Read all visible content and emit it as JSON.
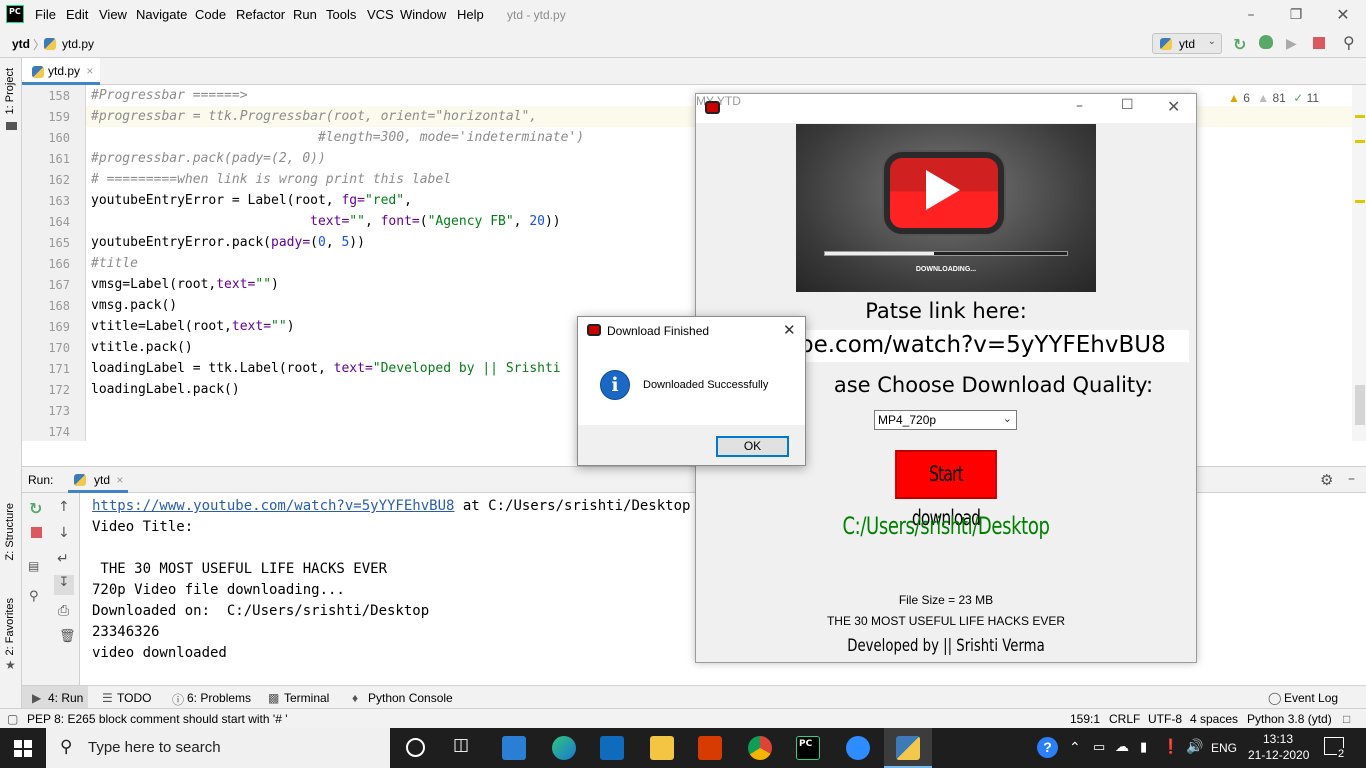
{
  "window": {
    "title": "ytd - ytd.py",
    "menu": [
      "File",
      "Edit",
      "View",
      "Navigate",
      "Code",
      "Refactor",
      "Run",
      "Tools",
      "VCS",
      "Window",
      "Help"
    ]
  },
  "navbar": {
    "project": "ytd",
    "file": "ytd.py",
    "run_config": "ytd"
  },
  "left_stripe": {
    "project": "1: Project",
    "structure": "Z: Structure",
    "favorites": "2: Favorites"
  },
  "editor": {
    "tab": "ytd.py",
    "line_numbers": [
      "158",
      "159",
      "160",
      "161",
      "162",
      "163",
      "164",
      "165",
      "166",
      "167",
      "168",
      "169",
      "170",
      "171",
      "172",
      "173",
      "174"
    ],
    "analysis": {
      "warnings": "6",
      "weak_warnings": "81",
      "typos": "11"
    },
    "code": {
      "l158": "#Progressbar ======>",
      "l159": "#progressbar = ttk.Progressbar(root, orient=\"horizontal\",",
      "l160": "                             #length=300, mode='indeterminate')",
      "l161": "#progressbar.pack(pady=(2, 0))",
      "l162": "# =========when link is wrong print this label",
      "l163a": "youtubeEntryError = Label(root, ",
      "l163b": "fg=",
      "l163c": "\"red\"",
      "l163d": ",",
      "l164a": "                            ",
      "l164b": "text=",
      "l164c": "\"\"",
      "l164d": ", ",
      "l164e": "font=",
      "l164f": "(",
      "l164g": "\"Agency FB\"",
      "l164h": ", ",
      "l164i": "20",
      "l164j": "))",
      "l165a": "youtubeEntryError.pack(",
      "l165b": "pady=",
      "l165c": "(",
      "l165d": "0",
      "l165e": ", ",
      "l165f": "5",
      "l165g": "))",
      "l166": "#title",
      "l167a": "vmsg=Label(root,",
      "l167b": "text=",
      "l167c": "\"\"",
      "l167d": ")",
      "l168": "vmsg.pack()",
      "l169a": "vtitle=Label(root,",
      "l169b": "text=",
      "l169c": "\"\"",
      "l169d": ")",
      "l170": "vtitle.pack()",
      "l171a": "loadingLabel = ttk.Label(root, ",
      "l171b": "text=",
      "l171c": "\"Developed by || Srishti",
      "l172": "loadingLabel.pack()"
    }
  },
  "run_panel": {
    "label": "Run:",
    "tab": "ytd",
    "console": {
      "url": "https://www.youtube.com/watch?v=5yYYFEhvBU8",
      "url_suffix": " at C:/Users/srishti/Desktop",
      "line2": "Video Title:",
      "line4": " THE 30 MOST USEFUL LIFE HACKS EVER",
      "line5": "720p Video file downloading...",
      "line6": "Downloaded on:  C:/Users/srishti/Desktop",
      "line7": "23346326",
      "line8": "video downloaded"
    }
  },
  "bottom_tools": {
    "run": "4: Run",
    "todo": "TODO",
    "problems": "6: Problems",
    "terminal": "Terminal",
    "python_console": "Python Console",
    "event_log": "Event Log"
  },
  "statusbar": {
    "message": "PEP 8: E265 block comment should start with '# '",
    "position": "159:1",
    "line_sep": "CRLF",
    "encoding": "UTF-8",
    "indent": "4 spaces",
    "interpreter": "Python 3.8 (ytd)"
  },
  "taskbar": {
    "search_placeholder": "Type here to search",
    "language": "ENG",
    "time": "13:13",
    "date": "21-12-2020",
    "notifications": "2"
  },
  "tk_app": {
    "title": "MY YTD",
    "image_caption": "DOWNLOADING...",
    "paste_label": "Patse link here:",
    "link_value": "be.com/watch?v=5yYYFEhvBU8",
    "quality_label": "ase Choose Download Quality:",
    "quality_value": "MP4_720p",
    "start_button": "Start download",
    "path": "C:/Users/srishti/Desktop",
    "file_size": "File Size = 23 MB",
    "video_title": "THE 30 MOST USEFUL LIFE HACKS EVER",
    "developer": "Developed by || Srishti Verma"
  },
  "messagebox": {
    "title": "Download Finished",
    "message": "Downloaded Successfully",
    "ok": "OK",
    "info_glyph": "i"
  },
  "colors": {
    "accent": "#4083c9",
    "comment": "#8c8c8c",
    "string": "#067d17",
    "keyword_param": "#660099",
    "start_button": "#ff0000",
    "path_text": "#008000"
  }
}
